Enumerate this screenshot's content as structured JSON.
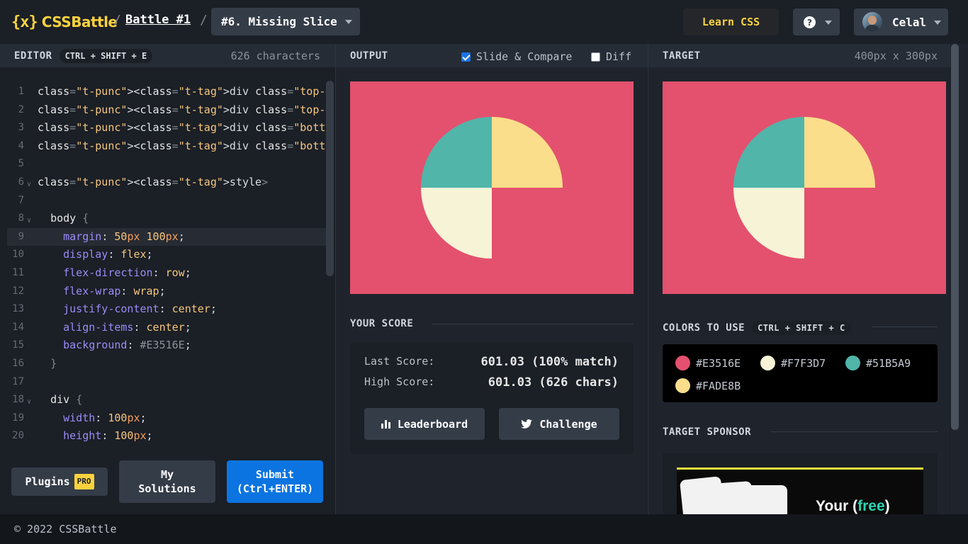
{
  "header": {
    "logo_mark": "{x}",
    "logo_text": "CSSBattle",
    "battle_link": "Battle #1",
    "level_select": "#6. Missing Slice",
    "learn_css": "Learn CSS",
    "help": "?",
    "user_name": "Celal"
  },
  "editor": {
    "title": "EDITOR",
    "shortcut": "CTRL + SHIFT + E",
    "chars": "626 characters",
    "plugins_label": "Plugins",
    "pro_badge": "PRO",
    "my_solutions_l1": "My",
    "my_solutions_l2": "Solutions",
    "submit_l1": "Submit",
    "submit_l2": "(Ctrl+ENTER)"
  },
  "code_lines": [
    "<div class=\"top-left\"></div>",
    "<div class=\"top-right\"></div>",
    "<div class=\"bottom-left\"></div>",
    "<div class=\"bottom-right\"></div>",
    "",
    "<style>",
    "",
    "  body {",
    "    margin: 50px 100px;",
    "    display: flex;",
    "    flex-direction: row;",
    "    flex-wrap: wrap;",
    "    justify-content: center;",
    "    align-items: center;",
    "    background: #E3516E;",
    "  }",
    "",
    "  div {",
    "    width: 100px;",
    "    height: 100px;"
  ],
  "output": {
    "title": "OUTPUT",
    "slide_compare": "Slide & Compare",
    "slide_checked": true,
    "diff": "Diff",
    "diff_checked": false
  },
  "score": {
    "title": "YOUR SCORE",
    "last_label": "Last Score:",
    "last_value": "601.03 (100% match)",
    "high_label": "High Score:",
    "high_value": "601.03 (626 chars)",
    "leaderboard": "Leaderboard",
    "challenge": "Challenge"
  },
  "target": {
    "title": "TARGET",
    "size": "400px x 300px",
    "colors_title": "COLORS TO USE",
    "colors_shortcut": "CTRL + SHIFT + C",
    "colors": [
      {
        "hex": "#E3516E",
        "label": "#E3516E"
      },
      {
        "hex": "#F7F3D7",
        "label": "#F7F3D7"
      },
      {
        "hex": "#51B5A9",
        "label": "#51B5A9"
      },
      {
        "hex": "#FADE8B",
        "label": "#FADE8B"
      }
    ],
    "sponsor_title": "TARGET SPONSOR",
    "ad_text_1": "Your (",
    "ad_text_free": "free",
    "ad_text_2": ")"
  },
  "footer": {
    "copyright": "© 2022 CSSBattle"
  },
  "theme": {
    "accent_yellow": "#f9d23d",
    "submit_blue": "#0b74e0",
    "bg": "#1b1f26"
  }
}
